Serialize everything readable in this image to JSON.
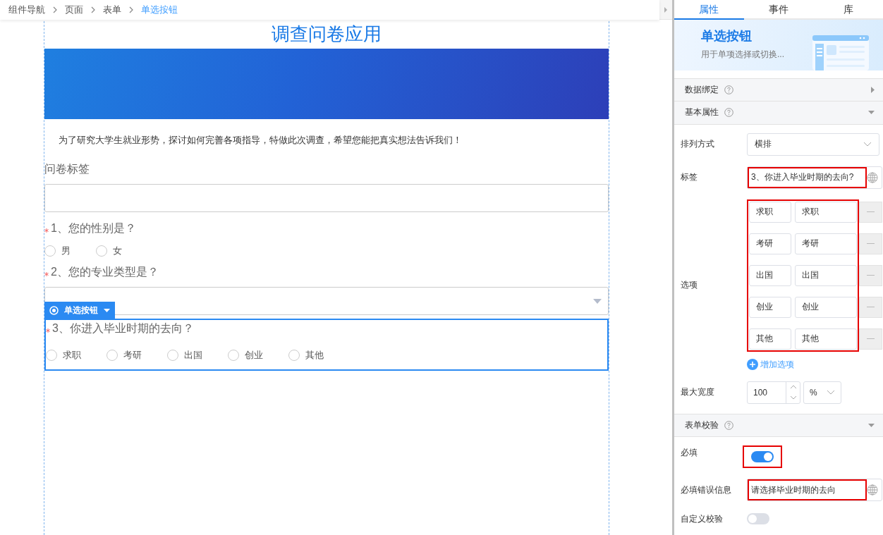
{
  "breadcrumb": [
    {
      "label": "组件导航",
      "selected": false
    },
    {
      "label": "页面",
      "selected": false
    },
    {
      "label": "表单",
      "selected": false
    },
    {
      "label": "单选按钮",
      "selected": true
    }
  ],
  "form": {
    "title": "调查问卷应用",
    "intro": "为了研究大学生就业形势，探讨如何完善各项指导，特做此次调查，希望您能把真实想法告诉我们！",
    "fields": [
      {
        "kind": "textbox",
        "label": "问卷标签",
        "required": false,
        "focused": false
      },
      {
        "kind": "radio",
        "label": "1、您的性别是？",
        "required": true,
        "focused": false,
        "options": [
          {
            "label": "男",
            "selected": false
          },
          {
            "label": "女",
            "selected": false
          }
        ]
      },
      {
        "kind": "select",
        "label": "2、您的专业类型是？",
        "required": true,
        "focused": false
      },
      {
        "kind": "radio",
        "label": "3、你进入毕业时期的去向？",
        "required": true,
        "focused": true,
        "tag": "单选按钮",
        "options": [
          {
            "label": "求职",
            "selected": false
          },
          {
            "label": "考研",
            "selected": false
          },
          {
            "label": "出国",
            "selected": false
          },
          {
            "label": "创业",
            "selected": false
          },
          {
            "label": "其他",
            "selected": false
          }
        ]
      }
    ]
  },
  "panel": {
    "tabs": [
      {
        "label": "属性",
        "selected": true
      },
      {
        "label": "事件",
        "selected": false
      },
      {
        "label": "库",
        "selected": false
      }
    ],
    "header": {
      "title": "单选按钮",
      "description": "用于单项选择或切换..."
    },
    "sections": [
      {
        "title": "数据绑定",
        "expanded": false
      },
      {
        "title": "基本属性",
        "expanded": true,
        "rows": [
          {
            "kind": "select",
            "label": "排列方式",
            "value": "横排",
            "highlighted": false
          },
          {
            "kind": "text",
            "label": "标签",
            "value": "3、你进入毕业时期的去向?",
            "highlighted": true
          },
          {
            "kind": "options",
            "label": "选项",
            "highlighted": true,
            "options": [
              {
                "label": "求职",
                "value": "求职"
              },
              {
                "label": "考研",
                "value": "考研"
              },
              {
                "label": "出国",
                "value": "出国"
              },
              {
                "label": "创业",
                "value": "创业"
              },
              {
                "label": "其他",
                "value": "其他"
              }
            ],
            "add_label": "增加选项"
          },
          {
            "kind": "number",
            "label": "最大宽度",
            "value": "100",
            "unit": "%",
            "highlighted": false
          }
        ]
      },
      {
        "title": "表单校验",
        "expanded": true,
        "rows": [
          {
            "kind": "toggle",
            "label": "必填",
            "on": true,
            "highlighted": true
          },
          {
            "kind": "text",
            "label": "必填错误信息",
            "value": "请选择毕业时期的去向",
            "highlighted": true
          },
          {
            "kind": "toggle",
            "label": "自定义校验",
            "on": false,
            "highlighted": false
          }
        ]
      }
    ]
  }
}
